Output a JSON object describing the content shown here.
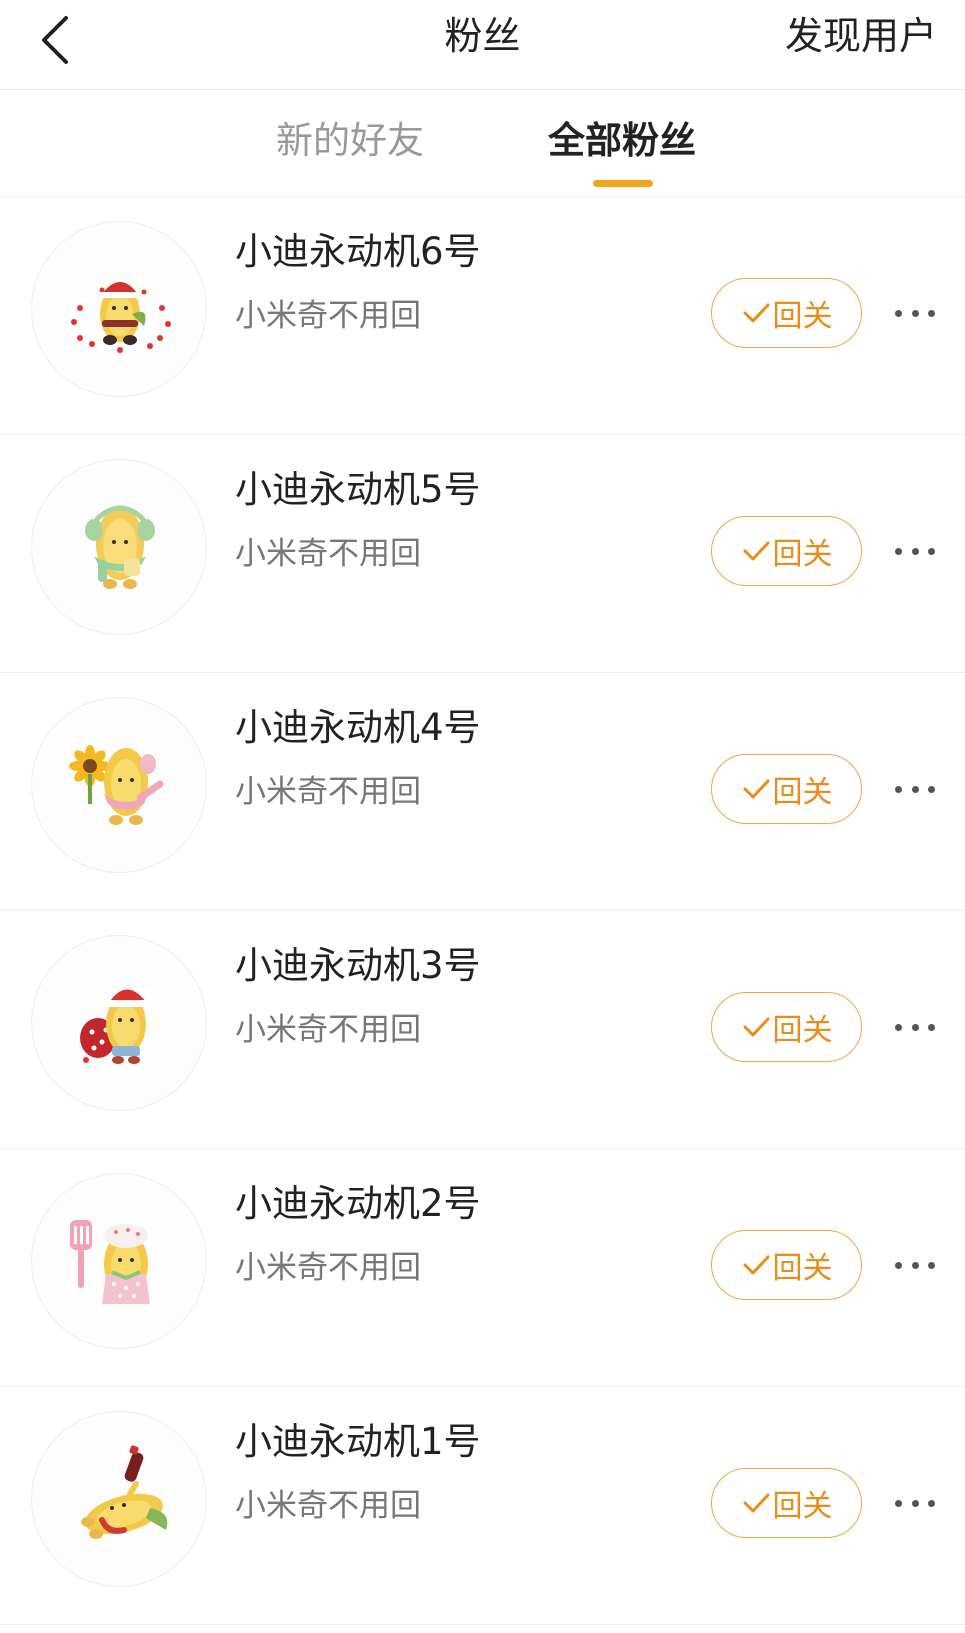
{
  "header": {
    "title": "粉丝",
    "discover_label": "发现用户"
  },
  "tabs": [
    {
      "label": "新的好友",
      "active": false
    },
    {
      "label": "全部粉丝",
      "active": true
    }
  ],
  "colors": {
    "accent": "#f2a51a",
    "follow_text": "#ea8c1a",
    "follow_border": "#f0a640"
  },
  "fans": [
    {
      "name": "小迪永动机6号",
      "subtitle": "小米奇不用回",
      "button_label": "回关",
      "avatar_icon": "corn-santa-hearts-icon"
    },
    {
      "name": "小迪永动机5号",
      "subtitle": "小米奇不用回",
      "button_label": "回关",
      "avatar_icon": "corn-earmuffs-icon"
    },
    {
      "name": "小迪永动机4号",
      "subtitle": "小米奇不用回",
      "button_label": "回关",
      "avatar_icon": "corn-sunflower-icon"
    },
    {
      "name": "小迪永动机3号",
      "subtitle": "小米奇不用回",
      "button_label": "回关",
      "avatar_icon": "corn-santa-bag-icon"
    },
    {
      "name": "小迪永动机2号",
      "subtitle": "小米奇不用回",
      "button_label": "回关",
      "avatar_icon": "corn-chef-spatula-icon"
    },
    {
      "name": "小迪永动机1号",
      "subtitle": "小米奇不用回",
      "button_label": "回关",
      "avatar_icon": "corn-lying-bottle-icon"
    }
  ]
}
